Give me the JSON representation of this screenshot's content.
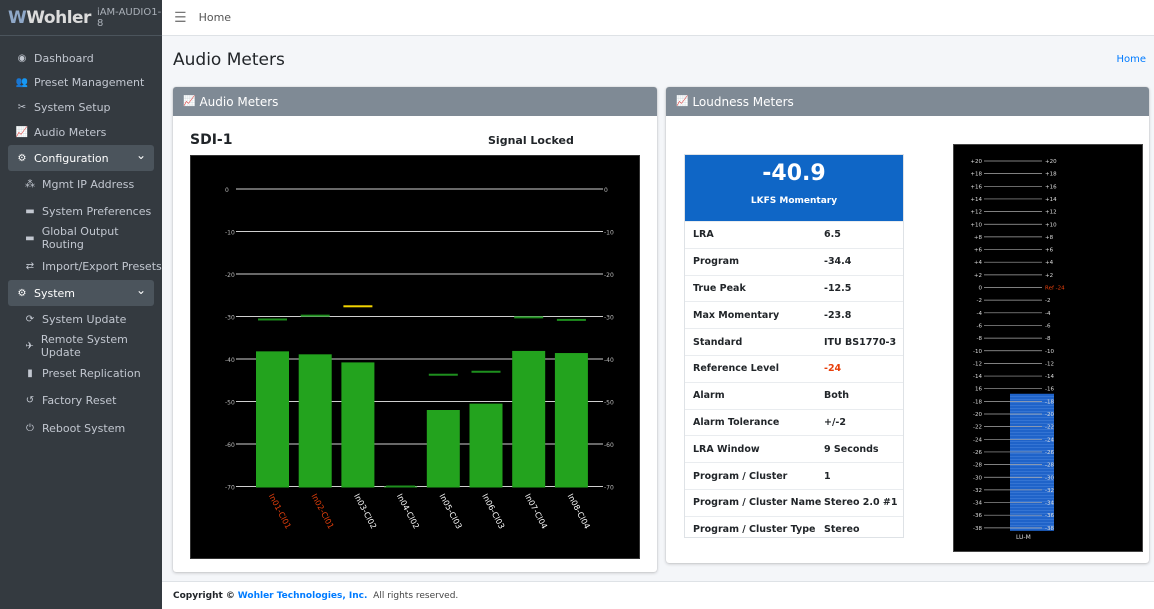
{
  "brand": {
    "logo": "Wohler",
    "model": "iAM-AUDIO1-8"
  },
  "topbar": {
    "menu_icon": "hamburger-icon",
    "crumb": "Home"
  },
  "sidebar": {
    "items": [
      {
        "label": "Dashboard",
        "icon": "dashboard-icon"
      },
      {
        "label": "Preset Management",
        "icon": "users-icon"
      },
      {
        "label": "System Setup",
        "icon": "tools-icon"
      },
      {
        "label": "Audio Meters",
        "icon": "chart-icon"
      },
      {
        "label": "Configuration",
        "icon": "gear-icon",
        "group": true
      },
      {
        "label": "Mgmt IP Address",
        "icon": "network-icon"
      },
      {
        "label": "System Preferences",
        "icon": "keyboard-icon"
      },
      {
        "label": "Global Output Routing",
        "icon": "keyboard-icon"
      },
      {
        "label": "Import/Export Presets",
        "icon": "swap-icon"
      },
      {
        "label": "System",
        "icon": "cogs-icon",
        "group": true
      },
      {
        "label": "System Update",
        "icon": "sync-icon"
      },
      {
        "label": "Remote System Update",
        "icon": "satellite-icon"
      },
      {
        "label": "Preset Replication",
        "icon": "copy-icon"
      },
      {
        "label": "Factory Reset",
        "icon": "undo-icon"
      },
      {
        "label": "Reboot System",
        "icon": "power-icon"
      }
    ]
  },
  "page": {
    "title": "Audio Meters",
    "crumb_right": "Home"
  },
  "audio_card": {
    "title": "Audio Meters",
    "source": "SDI-1",
    "status": "Signal Locked"
  },
  "loud_card": {
    "title": "Loudness Meters"
  },
  "loudness": {
    "value": "-40.9",
    "label": "LKFS  Momentary",
    "rows": [
      {
        "k": "LRA",
        "v": "6.5"
      },
      {
        "k": "Program",
        "v": "-34.4"
      },
      {
        "k": "True Peak",
        "v": "-12.5"
      },
      {
        "k": "Max Momentary",
        "v": "-23.8"
      },
      {
        "k": "Standard",
        "v": "ITU BS1770-3"
      },
      {
        "k": "Reference Level",
        "v": "-24",
        "red": true
      },
      {
        "k": "Alarm",
        "v": "Both"
      },
      {
        "k": "Alarm Tolerance",
        "v": "+/-2"
      },
      {
        "k": "LRA Window",
        "v": "9 Seconds"
      },
      {
        "k": "Program / Cluster",
        "v": "1"
      },
      {
        "k": "Program / Cluster Name",
        "v": "Stereo 2.0 #1"
      },
      {
        "k": "Program / Cluster Type",
        "v": "Stereo"
      }
    ]
  },
  "audio_meter": {
    "scale": [
      "0",
      "-10",
      "-20",
      "-30",
      "-40",
      "-50",
      "-60",
      "-70"
    ],
    "channels": [
      {
        "label": "In01-Cl01",
        "level": -38.2,
        "peak": -30.7,
        "peak_color": "#1e8f1e",
        "label_color": "#e8400c"
      },
      {
        "label": "In02-Cl01",
        "level": -38.9,
        "peak": -29.8,
        "peak_color": "#1e8f1e",
        "label_color": "#e8400c"
      },
      {
        "label": "In03-Cl02",
        "level": -40.8,
        "peak": -27.6,
        "peak_color": "#f2d400",
        "label_color": "#ffffff"
      },
      {
        "label": "In04-Cl02",
        "level": -70.0,
        "peak": -70.0,
        "peak_color": "#1e8f1e",
        "label_color": "#ffffff"
      },
      {
        "label": "In05-Cl03",
        "level": -52.0,
        "peak": -43.7,
        "peak_color": "#1e8f1e",
        "label_color": "#ffffff"
      },
      {
        "label": "In06-Cl03",
        "level": -50.5,
        "peak": -43.0,
        "peak_color": "#1e8f1e",
        "label_color": "#ffffff"
      },
      {
        "label": "In07-Cl04",
        "level": -38.1,
        "peak": -30.2,
        "peak_color": "#1e8f1e",
        "label_color": "#ffffff"
      },
      {
        "label": "In08-Cl04",
        "level": -38.6,
        "peak": -30.8,
        "peak_color": "#1e8f1e",
        "label_color": "#ffffff"
      }
    ]
  },
  "lu_meter": {
    "ticks_left": [
      "+20",
      "+18",
      "+16",
      "+14",
      "+12",
      "+10",
      "+8",
      "+6",
      "+4",
      "+2",
      "0",
      "-2",
      "-4",
      "-6",
      "-8",
      "-10",
      "-12",
      "-14",
      "16",
      "-18",
      "-20",
      "-22",
      "-24",
      "-26",
      "-28",
      "-30",
      "-32",
      "-34",
      "-36",
      "-38"
    ],
    "ticks_right": [
      "+20",
      "+18",
      "+16",
      "+14",
      "+12",
      "+10",
      "+8",
      "+6",
      "+4",
      "+2",
      "Ref -24",
      "-2",
      "-4",
      "-6",
      "-8",
      "-10",
      "-12",
      "-14",
      "-16",
      "-18",
      "-20",
      "-22",
      "-24",
      "-26",
      "-28",
      "-30",
      "-32",
      "-34",
      "-36",
      "-38"
    ],
    "ref_color": "#e8400c",
    "bar_color": "#1f63c9",
    "level": -16.8,
    "label": "LU-M"
  },
  "footer": {
    "prefix": "Copyright ©",
    "company": "Wohler Technologies, Inc.",
    "suffix": "All rights reserved."
  }
}
